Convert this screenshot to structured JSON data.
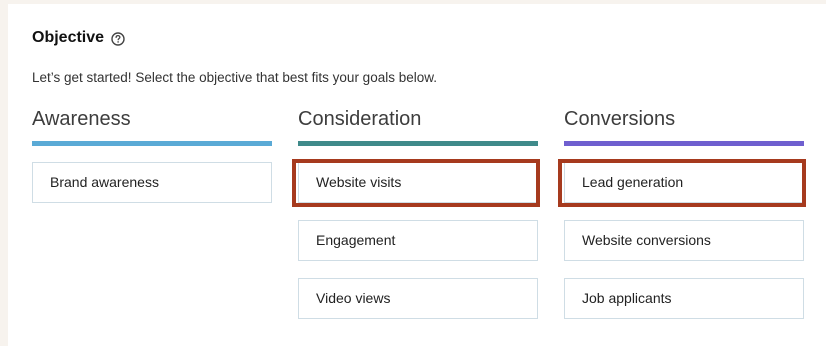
{
  "objective": {
    "title": "Objective",
    "help_icon": "question-circle-icon",
    "subtitle": "Let’s get started! Select the objective that best fits your goals below."
  },
  "columns": [
    {
      "heading": "Awareness",
      "color": "#5aaad6",
      "options": [
        {
          "label": "Brand awareness",
          "highlighted": false
        }
      ]
    },
    {
      "heading": "Consideration",
      "color": "#3f8a8a",
      "options": [
        {
          "label": "Website visits",
          "highlighted": true
        },
        {
          "label": "Engagement",
          "highlighted": false
        },
        {
          "label": "Video views",
          "highlighted": false
        }
      ]
    },
    {
      "heading": "Conversions",
      "color": "#6f5fcf",
      "options": [
        {
          "label": "Lead generation",
          "highlighted": true
        },
        {
          "label": "Website conversions",
          "highlighted": false
        },
        {
          "label": "Job applicants",
          "highlighted": false
        }
      ]
    }
  ],
  "colors": {
    "highlight_border": "#a63a1e",
    "option_border": "#cfdde5"
  }
}
